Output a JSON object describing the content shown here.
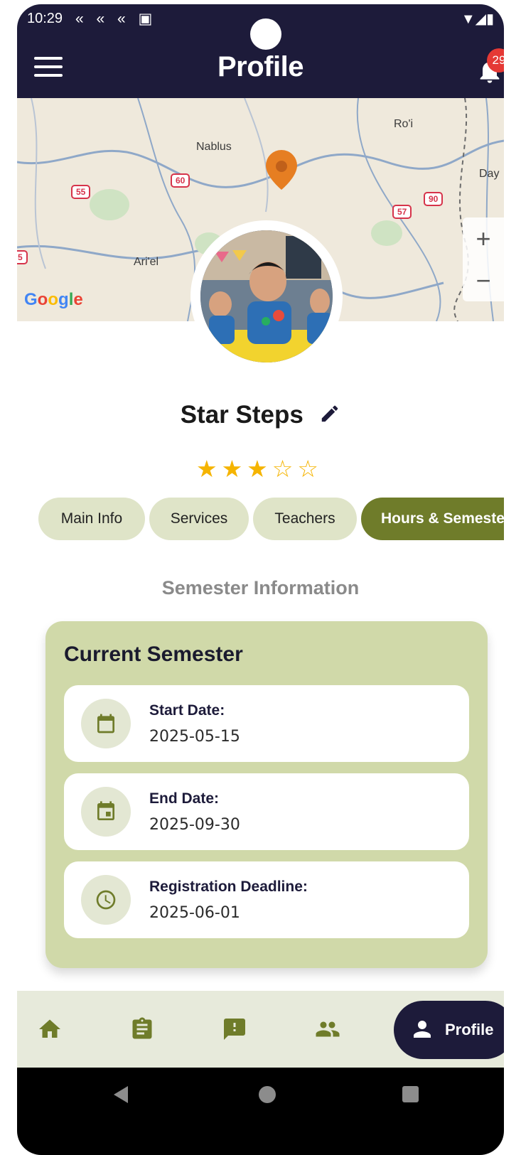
{
  "status_bar": {
    "time": "10:29",
    "left_icons": "« « « ▣",
    "right_icons": "▼◢▮"
  },
  "app_bar": {
    "title": "Profile",
    "notification_count": "29"
  },
  "map": {
    "labels": [
      "Nablus",
      "Ro'i",
      "Day",
      "Ari'el"
    ],
    "road_numbers": [
      "55",
      "60",
      "57",
      "90",
      "5"
    ],
    "zoom_in": "+",
    "zoom_out": "−",
    "attribution": "Google"
  },
  "profile": {
    "name": "Star Steps",
    "rating": 3,
    "rating_max": 5,
    "stars_text": "★★★☆☆"
  },
  "tabs": [
    {
      "label": "Main Info"
    },
    {
      "label": "Services"
    },
    {
      "label": "Teachers"
    },
    {
      "label": "Hours & Semeste"
    }
  ],
  "section_title": "Semester Information",
  "card": {
    "title": "Current Semester",
    "rows": [
      {
        "label": "Start Date:",
        "value": "2025-05-15",
        "icon": "calendar-icon"
      },
      {
        "label": "End Date:",
        "value": "2025-09-30",
        "icon": "event-icon"
      },
      {
        "label": "Registration Deadline:",
        "value": "2025-06-01",
        "icon": "clock-icon"
      }
    ]
  },
  "bottom_nav": {
    "items": [
      "home-icon",
      "clipboard-icon",
      "feedback-icon",
      "people-icon"
    ],
    "active_label": "Profile"
  },
  "colors": {
    "app_bar": "#1d1b3a",
    "accent_olive": "#6f7c2a",
    "card_bg": "#d0d9a9",
    "star": "#f5b400",
    "badge": "#e53935"
  }
}
